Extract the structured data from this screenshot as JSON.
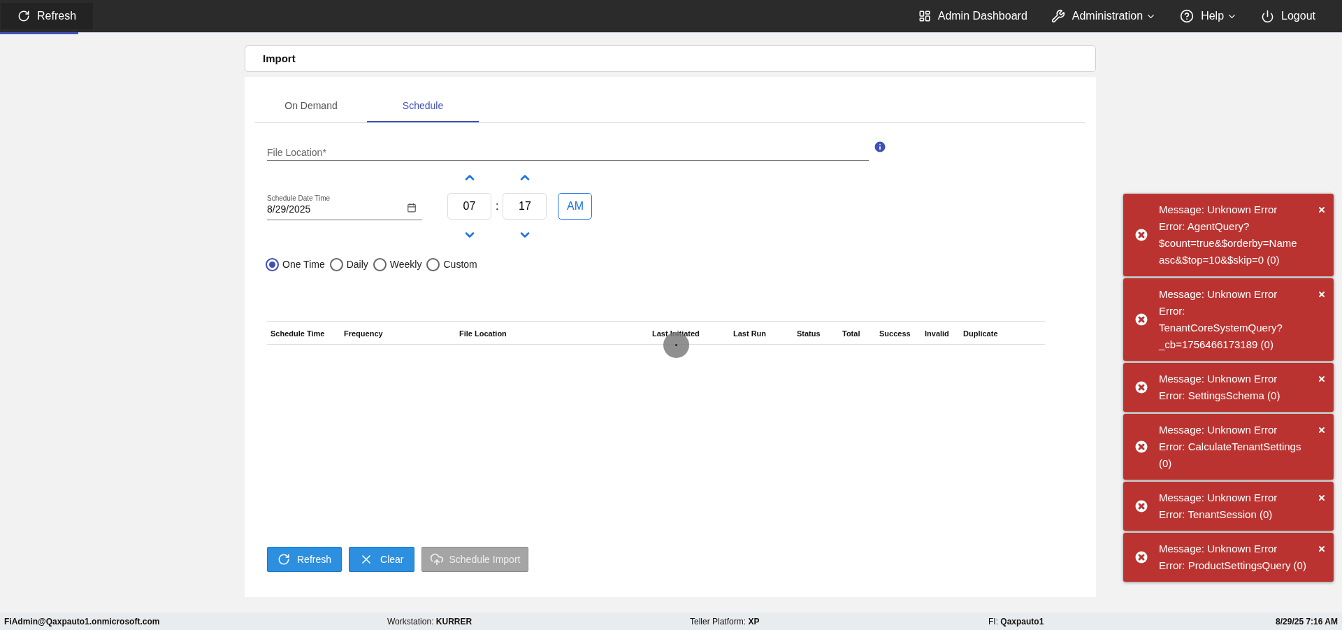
{
  "top_bar": {
    "refresh": "Refresh",
    "menu": [
      {
        "label": "Admin Dashboard",
        "kind": "dashboard",
        "dropdown": false
      },
      {
        "label": "Administration",
        "kind": "wrench",
        "dropdown": true
      },
      {
        "label": "Help",
        "kind": "help",
        "dropdown": true
      },
      {
        "label": "Logout",
        "kind": "power",
        "dropdown": false
      }
    ]
  },
  "page": {
    "title": "Import"
  },
  "tabs": [
    {
      "label": "On Demand",
      "selected": false
    },
    {
      "label": "Schedule",
      "selected": true
    }
  ],
  "form": {
    "file_location": {
      "placeholder": "File Location*"
    },
    "schedule_date": {
      "label": "Schedule Date Time",
      "value": "8/29/2025"
    },
    "hour": "07",
    "separator": ":",
    "minute": "17",
    "period": "AM",
    "recurrence": [
      {
        "label": "One Time",
        "selected": true
      },
      {
        "label": "Daily",
        "selected": false
      },
      {
        "label": "Weekly",
        "selected": false
      },
      {
        "label": "Custom",
        "selected": false
      }
    ]
  },
  "table": {
    "columns": [
      "Schedule Time",
      "Frequency",
      "File Location",
      "Last Initiated",
      "Last Run",
      "Status",
      "Total",
      "Success",
      "Invalid",
      "Duplicate"
    ],
    "loading": true
  },
  "buttons": [
    {
      "label": "Refresh",
      "kind": "refresh",
      "disabled": false
    },
    {
      "label": "Clear",
      "kind": "clear",
      "disabled": false
    },
    {
      "label": "Schedule Import",
      "kind": "upload",
      "disabled": true
    }
  ],
  "status_bar": {
    "user": "FiAdmin@Qaxpauto1.onmicrosoft.com",
    "items": [
      {
        "label": "Workstation:",
        "value": "KURRER"
      },
      {
        "label": "Teller Platform:",
        "value": "XP"
      },
      {
        "label": "FI:",
        "value": "Qaxpauto1"
      }
    ],
    "datetime": "8/29/25 7:16 AM"
  },
  "toasts": [
    {
      "message": "Message: Unknown Error",
      "error": "Error: AgentQuery? $count=true&$orderby=Name asc&$top=10&$skip=0 (0)"
    },
    {
      "message": "Message: Unknown Error",
      "error": "Error: TenantCoreSystemQuery? _cb=1756466173189 (0)"
    },
    {
      "message": "Message: Unknown Error",
      "error": "Error: SettingsSchema (0)"
    },
    {
      "message": "Message: Unknown Error",
      "error": "Error: CalculateTenantSettings (0)"
    },
    {
      "message": "Message: Unknown Error",
      "error": "Error: TenantSession (0)"
    },
    {
      "message": "Message: Unknown Error",
      "error": "Error: ProductSettingsQuery (0)"
    }
  ]
}
